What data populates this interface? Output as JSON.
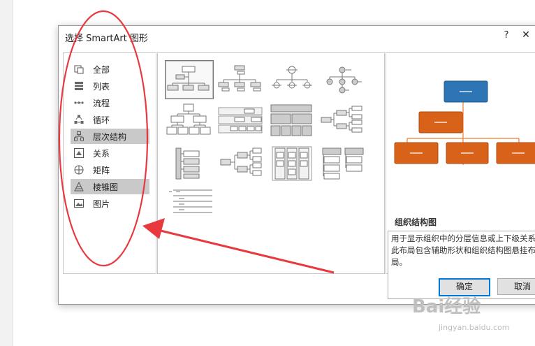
{
  "dialog": {
    "title": "选择 SmartArt 图形",
    "help_label": "?",
    "close_label": "✕"
  },
  "categories": [
    {
      "label": "全部",
      "icon": "all-icon"
    },
    {
      "label": "列表",
      "icon": "list-icon"
    },
    {
      "label": "流程",
      "icon": "process-icon"
    },
    {
      "label": "循环",
      "icon": "cycle-icon"
    },
    {
      "label": "层次结构",
      "icon": "hierarchy-icon",
      "selected": true
    },
    {
      "label": "关系",
      "icon": "relationship-icon"
    },
    {
      "label": "矩阵",
      "icon": "matrix-icon"
    },
    {
      "label": "棱锥图",
      "icon": "pyramid-icon",
      "highlighted": true
    },
    {
      "label": "图片",
      "icon": "picture-icon"
    }
  ],
  "preview": {
    "title": "组织结构图",
    "description": "用于显示组织中的分层信息或上下级关系。此布局包含辅助形状和组织结构图悬挂布局。",
    "colors": {
      "top": "#2e75b6",
      "mid": "#ed7d31",
      "bottom": "#ed7d31"
    }
  },
  "buttons": {
    "ok": "确定",
    "cancel": "取消"
  },
  "watermark": {
    "brand": "Bai经验",
    "url": "jingyan.baidu.com"
  },
  "annotation_color": "#e8393f"
}
